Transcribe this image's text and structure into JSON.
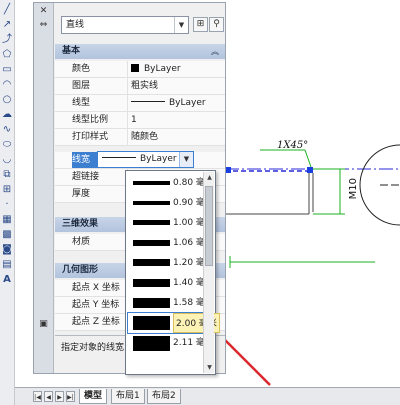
{
  "palette": {
    "object_type": "直线",
    "sections": {
      "general": "基本",
      "3d_effects": "三维效果",
      "geometry": "几何图形"
    },
    "properties": {
      "color": {
        "label": "颜色",
        "value": "ByLayer"
      },
      "layer": {
        "label": "图层",
        "value": "粗实线"
      },
      "linetype": {
        "label": "线型",
        "value": "ByLayer"
      },
      "linetype_scale": {
        "label": "线型比例",
        "value": "1"
      },
      "plot_style": {
        "label": "打印样式",
        "value": "随颜色"
      },
      "lineweight": {
        "label": "线宽",
        "value": "ByLayer"
      },
      "hyperlink": {
        "label": "超链接",
        "value": ""
      },
      "thickness": {
        "label": "厚度",
        "value": ""
      },
      "material": {
        "label": "材质",
        "value": ""
      },
      "start_x": {
        "label": "起点 X 坐标",
        "value": ""
      },
      "start_y": {
        "label": "起点 Y 坐标",
        "value": ""
      },
      "start_z": {
        "label": "起点 Z 坐标",
        "value": ""
      }
    },
    "description": "指定对象的线宽"
  },
  "lineweight_options": [
    {
      "label": "0.80 毫..."
    },
    {
      "label": "0.90 毫..."
    },
    {
      "label": "1.00 毫..."
    },
    {
      "label": "1.06 毫..."
    },
    {
      "label": "1.20 毫..."
    },
    {
      "label": "1.40 毫..."
    },
    {
      "label": "1.58 毫..."
    },
    {
      "label": "2.00 毫米"
    },
    {
      "label": "2.11 毫..."
    }
  ],
  "lineweight_highlighted": "2.00 毫米",
  "drawing": {
    "chamfer_label": "1X45°",
    "dimension_label": "M10"
  },
  "layout_tabs": {
    "model": "模型",
    "layout1": "布局1",
    "layout2": "布局2"
  },
  "colors": {
    "accent": "#3c7fd1",
    "annotation_arrow": "#d9272d",
    "dimension_green": "#19b21f",
    "selection_grip": "#1a3fe0"
  }
}
